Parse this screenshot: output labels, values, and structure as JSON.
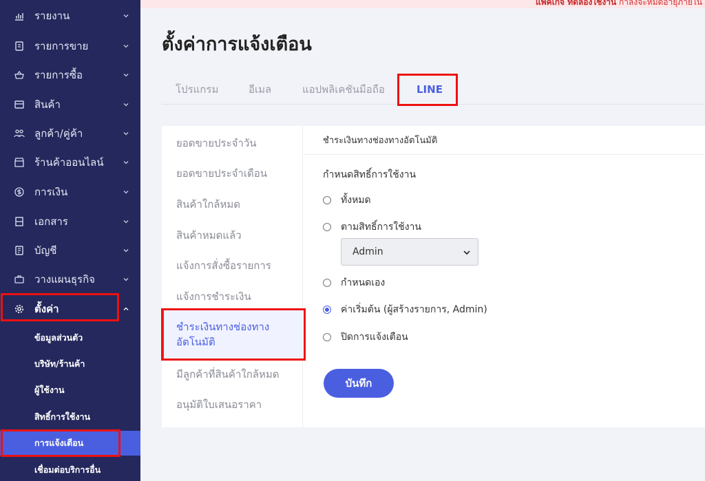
{
  "banner": {
    "bold": "แพ็คเกจ ทดลองใช้งาน",
    "text": " กำลังจะหมดอายุภายใน"
  },
  "sidebar": {
    "items": [
      {
        "label": "รายงาน",
        "icon": "chart-icon"
      },
      {
        "label": "รายการขาย",
        "icon": "receipt-icon"
      },
      {
        "label": "รายการซื้อ",
        "icon": "basket-icon"
      },
      {
        "label": "สินค้า",
        "icon": "box-icon"
      },
      {
        "label": "ลูกค้า/คู่ค้า",
        "icon": "users-icon"
      },
      {
        "label": "ร้านค้าออนไลน์",
        "icon": "store-icon"
      },
      {
        "label": "การเงิน",
        "icon": "dollar-icon"
      },
      {
        "label": "เอกสาร",
        "icon": "document-icon"
      },
      {
        "label": "บัญชี",
        "icon": "ledger-icon"
      },
      {
        "label": "วางแผนธุรกิจ",
        "icon": "briefcase-icon"
      },
      {
        "label": "ตั้งค่า",
        "icon": "gear-icon"
      }
    ],
    "subitems": [
      {
        "label": "ข้อมูลส่วนตัว"
      },
      {
        "label": "บริษัท/ร้านค้า"
      },
      {
        "label": "ผู้ใช้งาน"
      },
      {
        "label": "สิทธิ์การใช้งาน"
      },
      {
        "label": "การแจ้งเตือน"
      },
      {
        "label": "เชื่อมต่อบริการอื่น"
      }
    ]
  },
  "page": {
    "title": "ตั้งค่าการแจ้งเตือน"
  },
  "tabs": [
    {
      "label": "โปรแกรม"
    },
    {
      "label": "อีเมล"
    },
    {
      "label": "แอปพลิเคชันมือถือ"
    },
    {
      "label": "LINE"
    }
  ],
  "subnav": [
    {
      "label": "ยอดขายประจำวัน"
    },
    {
      "label": "ยอดขายประจำเดือน"
    },
    {
      "label": "สินค้าใกล้หมด"
    },
    {
      "label": "สินค้าหมดแล้ว"
    },
    {
      "label": "แจ้งการสั่งซื้อรายการ"
    },
    {
      "label": "แจ้งการชำระเงิน"
    },
    {
      "label": "ชำระเงินทางช่องทางอัตโนมัติ"
    },
    {
      "label": "มีลูกค้าที่สินค้าใกล้หมด"
    },
    {
      "label": "อนุมัติใบเสนอราคา"
    }
  ],
  "panel": {
    "heading": "ชำระเงินทางช่องทางอัตโนมัติ",
    "group_label": "กำหนดสิทธิ์การใช้งาน",
    "options": [
      {
        "label": "ทั้งหมด",
        "checked": false
      },
      {
        "label": "ตามสิทธิ์การใช้งาน",
        "checked": false
      },
      {
        "label": "กำหนดเอง",
        "checked": false
      },
      {
        "label": "ค่าเริ่มต้น (ผู้สร้างรายการ, Admin)",
        "checked": true
      },
      {
        "label": "ปิดการแจ้งเตือน",
        "checked": false
      }
    ],
    "role_select": {
      "value": "Admin"
    },
    "save_label": "บันทึก"
  },
  "colors": {
    "sidebar": "#24285c",
    "accent": "#4a5fe0",
    "highlight": "#e11111"
  }
}
